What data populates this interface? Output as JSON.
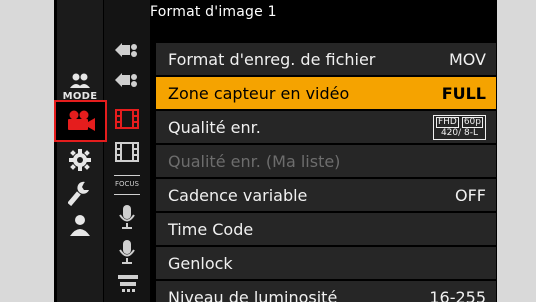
{
  "header": {
    "title": "Format d'image 1"
  },
  "left_tabs": {
    "mode_label": "MODE"
  },
  "menu": {
    "items": [
      {
        "label": "Format d'enreg. de fichier",
        "value": "MOV",
        "state": "normal"
      },
      {
        "label": "Zone capteur en vidéo",
        "value": "FULL",
        "state": "selected"
      },
      {
        "label": "Qualité enr.",
        "value_top_left": "FHD",
        "value_top_right": "60p",
        "value_bottom": "420/ 8-L",
        "state": "normal"
      },
      {
        "label": "Qualité enr. (Ma liste)",
        "value": "",
        "state": "disabled"
      },
      {
        "label": "Cadence variable",
        "value": "OFF",
        "state": "normal"
      },
      {
        "label": "Time Code",
        "value": "",
        "state": "normal"
      },
      {
        "label": "Genlock",
        "value": "",
        "state": "normal"
      },
      {
        "label": "Niveau de luminosité",
        "value": "16-255",
        "state": "normal"
      }
    ]
  },
  "sub_tabs": {
    "focus_label": "FOCUS"
  },
  "colors": {
    "highlight": "#f5a300",
    "active_tab_border": "#e51d1d",
    "video_icon": "#e51d1d",
    "row_bg": "#262626"
  }
}
